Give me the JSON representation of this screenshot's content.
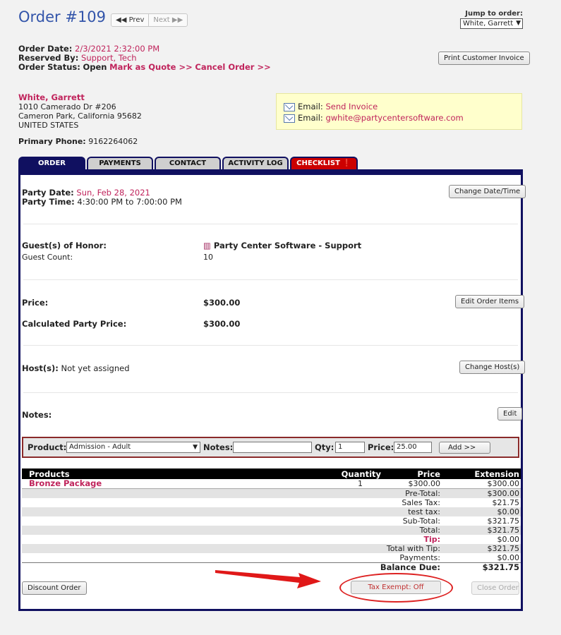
{
  "header": {
    "title": "Order #109",
    "prev_label": "Prev",
    "next_label": "Next",
    "jump_label": "Jump to order:",
    "jump_value": "White, Garrett",
    "print_button": "Print Customer Invoice"
  },
  "order_info": {
    "date_label": "Order Date:",
    "date_value": "2/3/2021 2:32:00 PM",
    "reserved_label": "Reserved By:",
    "reserved_value": "Support, Tech",
    "status_label": "Order Status:",
    "status_value": "Open",
    "mark_quote": "Mark as Quote >>",
    "cancel_order": "Cancel Order >>"
  },
  "customer": {
    "name": "White, Garrett",
    "street": "1010 Camerado Dr #206",
    "city": "Cameron Park, California 95682",
    "country": "UNITED STATES",
    "phone_label": "Primary Phone:",
    "phone": "9162264062",
    "email_label": "Email:",
    "send_invoice": "Send Invoice",
    "email": "gwhite@partycentersoftware.com"
  },
  "tabs": [
    "ORDER",
    "PAYMENTS",
    "CONTACT",
    "ACTIVITY LOG",
    "CHECKLIST"
  ],
  "party": {
    "date_label": "Party Date:",
    "date_value": "Sun, Feb 28, 2021",
    "time_label": "Party Time:",
    "time_value": "4:30:00 PM to 7:00:00 PM",
    "change_date": "Change Date/Time",
    "guest_label": "Guest(s) of Honor:",
    "guest_value": "Party Center Software - Support",
    "count_label": "Guest Count:",
    "count_value": "10",
    "price_label": "Price:",
    "price_value": "$300.00",
    "edit_items": "Edit Order Items",
    "calc_label": "Calculated Party Price:",
    "calc_value": "$300.00",
    "host_label": "Host(s):",
    "host_value": "Not yet assigned",
    "change_host": "Change Host(s)",
    "notes_label": "Notes:",
    "edit_notes": "Edit"
  },
  "product_bar": {
    "product_label": "Product:",
    "product_value": "Admission - Adult",
    "notes_label": "Notes:",
    "qty_label": "Qty:",
    "qty_value": "1",
    "price_label": "Price:",
    "price_value": "25.00",
    "add_button": "Add >>"
  },
  "items": {
    "headers": [
      "Products",
      "Quantity",
      "Price",
      "Extension"
    ],
    "row": {
      "name": "Bronze Package",
      "qty": "1",
      "price": "$300.00",
      "ext": "$300.00"
    },
    "totals": [
      {
        "label": "Pre-Total:",
        "value": "$300.00"
      },
      {
        "label": "Sales Tax:",
        "value": "$21.75"
      },
      {
        "label": "test tax:",
        "value": "$0.00"
      },
      {
        "label": "Sub-Total:",
        "value": "$321.75"
      },
      {
        "label": "Total:",
        "value": "$321.75"
      },
      {
        "label": "Tip:",
        "value": "$0.00"
      },
      {
        "label": "Total with Tip:",
        "value": "$321.75"
      },
      {
        "label": "Payments:",
        "value": "$0.00"
      },
      {
        "label": "Balance Due:",
        "value": "$321.75"
      }
    ]
  },
  "footer": {
    "discount": "Discount Order",
    "tax_exempt": "Tax Exempt: Off",
    "close_order": "Close Order"
  }
}
